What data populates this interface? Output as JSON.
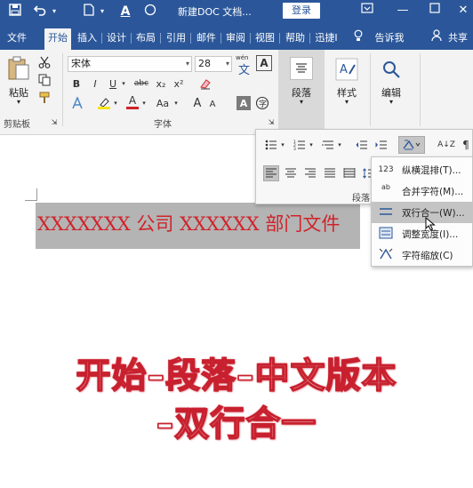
{
  "titlebar": {
    "doc_title": "新建DOC 文档...",
    "login_label": "登录",
    "icons": [
      "save-icon",
      "undo-icon",
      "document-icon",
      "font-color-icon",
      "circle-icon"
    ]
  },
  "tabs": [
    {
      "label": "文件"
    },
    {
      "label": "开始"
    },
    {
      "label": "插入"
    },
    {
      "label": "设计"
    },
    {
      "label": "布局"
    },
    {
      "label": "引用"
    },
    {
      "label": "邮件"
    },
    {
      "label": "审阅"
    },
    {
      "label": "视图"
    },
    {
      "label": "帮助"
    },
    {
      "label": "迅捷I"
    },
    {
      "label": "告诉我"
    },
    {
      "label": "共享"
    }
  ],
  "ribbon": {
    "paste_label": "粘贴",
    "clipboard_label": "剪贴板",
    "font_name": "宋体",
    "font_size": "28",
    "wen_glyph": "wén",
    "font_group_label": "字体",
    "paragraph_label": "段落",
    "styles_label": "样式",
    "edit_label": "编辑",
    "bold": "B",
    "italic": "I",
    "underline": "U",
    "strike": "abc",
    "sub": "x₂",
    "sup": "x²",
    "aa": "Aa",
    "grow": "A",
    "shrink": "A",
    "char_border": "A",
    "font_box_a": "A",
    "font_color_a": "A"
  },
  "para_panel": {
    "label": "段落",
    "sort_label": "A↓Z"
  },
  "menu": {
    "items": [
      {
        "icon": "123",
        "label": "纵横混排(T)..."
      },
      {
        "icon": "ab",
        "label": "合并字符(M)..."
      },
      {
        "icon": "",
        "label": "双行合一(W)..."
      },
      {
        "icon": "",
        "label": "调整宽度(I)..."
      },
      {
        "icon": "",
        "label": "字符缩放(C)"
      }
    ],
    "hovered_index": 2
  },
  "document": {
    "selected_text": "XXXXXXX 公司 XXXXXX 部门文件"
  },
  "overlay": {
    "line1": "开始–段落–中文版本",
    "line2": "–双行合一"
  },
  "colors": {
    "accent": "#2b579a",
    "document_text": "#d0232a",
    "overlay_stroke": "#c8202e"
  }
}
